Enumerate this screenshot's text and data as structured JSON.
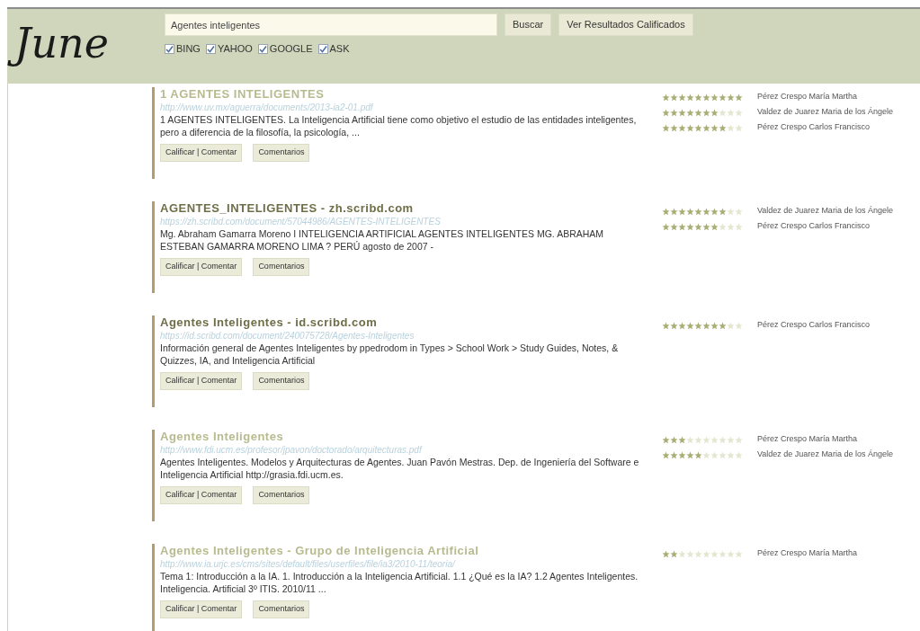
{
  "logo": "June",
  "search": {
    "value": "Agentes inteligentes",
    "buttons": [
      "Buscar",
      "Ver Resultados Calificados"
    ]
  },
  "engines": [
    {
      "label": "BING",
      "checked": true
    },
    {
      "label": "YAHOO",
      "checked": true
    },
    {
      "label": "GOOGLE",
      "checked": true
    },
    {
      "label": "ASK",
      "checked": true
    }
  ],
  "results": [
    {
      "title": "1 AGENTES INTELIGENTES",
      "visited": true,
      "url": "http://www.uv.mx/aguerra/documents/2013-ia2-01.pdf",
      "snippet": "1 AGENTES INTELIGENTES. La Inteligencia Artificial tiene como objetivo el estudio de las entidades inteligentes, pero a diferencia de la filosofía, la psicología, ...",
      "buttons": [
        "Calificar | Comentar",
        "Comentarios"
      ],
      "ratings": [
        {
          "stars": 10,
          "name": "Pérez Crespo María Martha"
        },
        {
          "stars": 7,
          "name": "Valdez de Juarez Maria de los Ángele"
        },
        {
          "stars": 8,
          "name": "Pérez Crespo Carlos Francisco"
        }
      ]
    },
    {
      "title": "AGENTES_INTELIGENTES - zh.scribd.com",
      "visited": false,
      "url": "https://zh.scribd.com/document/57044986/AGENTES-INTELIGENTES",
      "snippet": "Mg. Abraham Gamarra Moreno I INTELIGENCIA ARTIFICIAL AGENTES INTELIGENTES MG. ABRAHAM ESTEBAN GAMARRA MORENO LIMA ? PERÚ agosto de 2007 -",
      "buttons": [
        "Calificar | Comentar",
        "Comentarios"
      ],
      "ratings": [
        {
          "stars": 8,
          "name": "Valdez de Juarez Maria de los Ángele"
        },
        {
          "stars": 7,
          "name": "Pérez Crespo Carlos Francisco"
        }
      ]
    },
    {
      "title": "Agentes Inteligentes - id.scribd.com",
      "visited": false,
      "url": "https://id.scribd.com/document/240075728/Agentes-Inteligentes",
      "snippet": "Información general de Agentes Inteligentes by ppedrodom in Types > School Work > Study Guides, Notes, & Quizzes, IA, and Inteligencia Artificial",
      "buttons": [
        "Calificar | Comentar",
        "Comentarios"
      ],
      "ratings": [
        {
          "stars": 8,
          "name": "Pérez Crespo Carlos Francisco"
        }
      ]
    },
    {
      "title": "Agentes Inteligentes",
      "visited": true,
      "url": "http://www.fdi.ucm.es/profesor/jpavon/doctorado/arquitecturas.pdf",
      "snippet": "Agentes Inteligentes. Modelos y Arquitecturas de Agentes. Juan Pavón Mestras. Dep. de Ingeniería del Software e Inteligencia Artificial http://grasia.fdi.ucm.es.",
      "buttons": [
        "Calificar | Comentar",
        "Comentarios"
      ],
      "ratings": [
        {
          "stars": 3,
          "name": "Pérez Crespo María Martha"
        },
        {
          "stars": 5,
          "name": "Valdez de Juarez Maria de los Ángele"
        }
      ]
    },
    {
      "title": "Agentes Inteligentes - Grupo de Inteligencia Artificial",
      "visited": true,
      "url": "http://www.ia.urjc.es/cms/sites/default/files/userfiles/file/ia3/2010-11/teoria/",
      "snippet": "Tema 1: Introducción a la IA. 1. Introducción a la Inteligencia Artificial. 1.1 ¿Qué es la IA? 1.2 Agentes Inteligentes. Inteligencia. Artificial 3º ITIS. 2010/11 ...",
      "buttons": [
        "Calificar | Comentar",
        "Comentarios"
      ],
      "ratings": [
        {
          "stars": 2,
          "name": "Pérez Crespo María Martha"
        }
      ]
    }
  ]
}
